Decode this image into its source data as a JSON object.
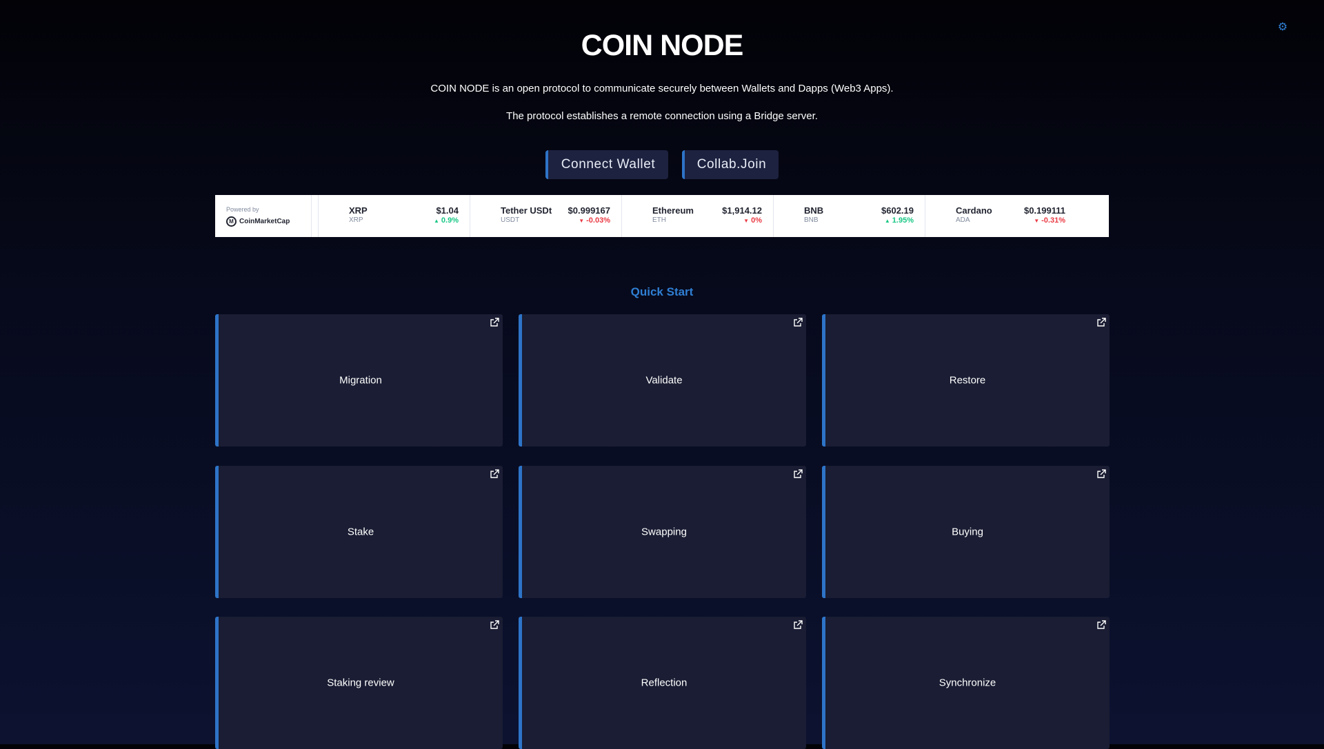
{
  "header": {
    "title": "COIN NODE",
    "description_line1": "COIN NODE is an open protocol to communicate securely between Wallets and Dapps (Web3 Apps).",
    "description_line2": "The protocol establishes a remote connection using a Bridge server.",
    "settings_icon": "gear-icon"
  },
  "actions": {
    "connect_label": "Connect Wallet",
    "collab_label": "Collab.Join"
  },
  "ticker": {
    "powered_by": "Powered by",
    "provider": "CoinMarketCap",
    "coins": [
      {
        "name": "XRP",
        "symbol": "XRP",
        "price": "$1.04",
        "change": "0.9%",
        "direction": "up"
      },
      {
        "name": "Tether USDt",
        "symbol": "USDT",
        "price": "$0.999167",
        "change": "-0.03%",
        "direction": "down"
      },
      {
        "name": "Ethereum",
        "symbol": "ETH",
        "price": "$1,914.12",
        "change": "0%",
        "direction": "down"
      },
      {
        "name": "BNB",
        "symbol": "BNB",
        "price": "$602.19",
        "change": "1.95%",
        "direction": "up"
      },
      {
        "name": "Cardano",
        "symbol": "ADA",
        "price": "$0.199111",
        "change": "-0.31%",
        "direction": "down"
      }
    ],
    "colors": {
      "up": "#16c784",
      "down": "#ea3943"
    }
  },
  "quick_start": {
    "title": "Quick Start",
    "items": [
      {
        "label": "Migration"
      },
      {
        "label": "Validate"
      },
      {
        "label": "Restore"
      },
      {
        "label": "Stake"
      },
      {
        "label": "Swapping"
      },
      {
        "label": "Buying"
      },
      {
        "label": "Staking review"
      },
      {
        "label": "Reflection"
      },
      {
        "label": "Synchronize"
      }
    ]
  },
  "colors": {
    "accent": "#2e74c8",
    "card_bg": "#1a1d33",
    "background": "#070a1c"
  }
}
